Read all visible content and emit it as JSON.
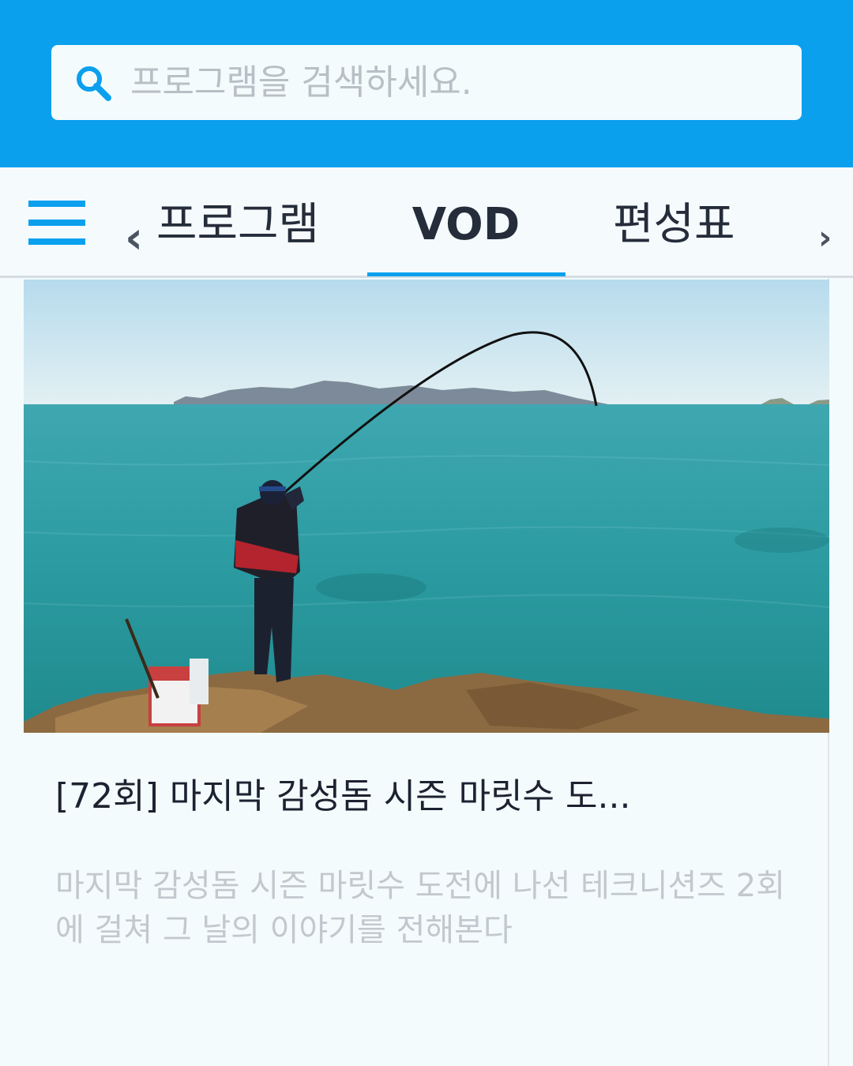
{
  "search": {
    "placeholder": "프로그램을 검색하세요.",
    "icon": "search-icon"
  },
  "nav": {
    "menu_icon": "hamburger-menu-icon",
    "tabs": [
      {
        "label": "프로그램",
        "active": false
      },
      {
        "label": "VOD",
        "active": true
      },
      {
        "label": "편성표",
        "active": false
      }
    ],
    "prev_icon": "chevron-left-icon",
    "next_icon": "chevron-right-icon"
  },
  "video": {
    "title": "[72회] 마지막 감성돔 시즌 마릿수 도...",
    "description": "마지막 감성돔 시즌 마릿수 도전에 나선 테크니션즈 2회에 걸쳐 그 날의 이야기를 전해본다"
  },
  "colors": {
    "accent": "#0aa0ee",
    "background": "#f3fbfd",
    "title_text": "#1c2230",
    "muted_text": "#c2c8cd"
  }
}
